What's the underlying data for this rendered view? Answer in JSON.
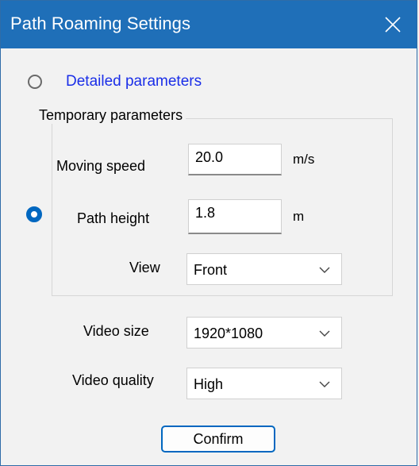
{
  "window": {
    "title": "Path Roaming Settings"
  },
  "options": {
    "detailed_label": "Detailed parameters",
    "temporary_label": "Temporary parameters"
  },
  "fields": {
    "moving_speed": {
      "label": "Moving speed",
      "value": "20.0",
      "unit": "m/s"
    },
    "path_height": {
      "label": "Path height",
      "value": "1.8",
      "unit": "m"
    },
    "view": {
      "label": "View",
      "value": "Front"
    },
    "video_size": {
      "label": "Video size",
      "value": "1920*1080"
    },
    "video_quality": {
      "label": "Video quality",
      "value": "High"
    }
  },
  "buttons": {
    "confirm": "Confirm"
  },
  "colors": {
    "titlebar": "#1f6fb8",
    "accent": "#0067c0",
    "link": "#1a2ee8"
  }
}
